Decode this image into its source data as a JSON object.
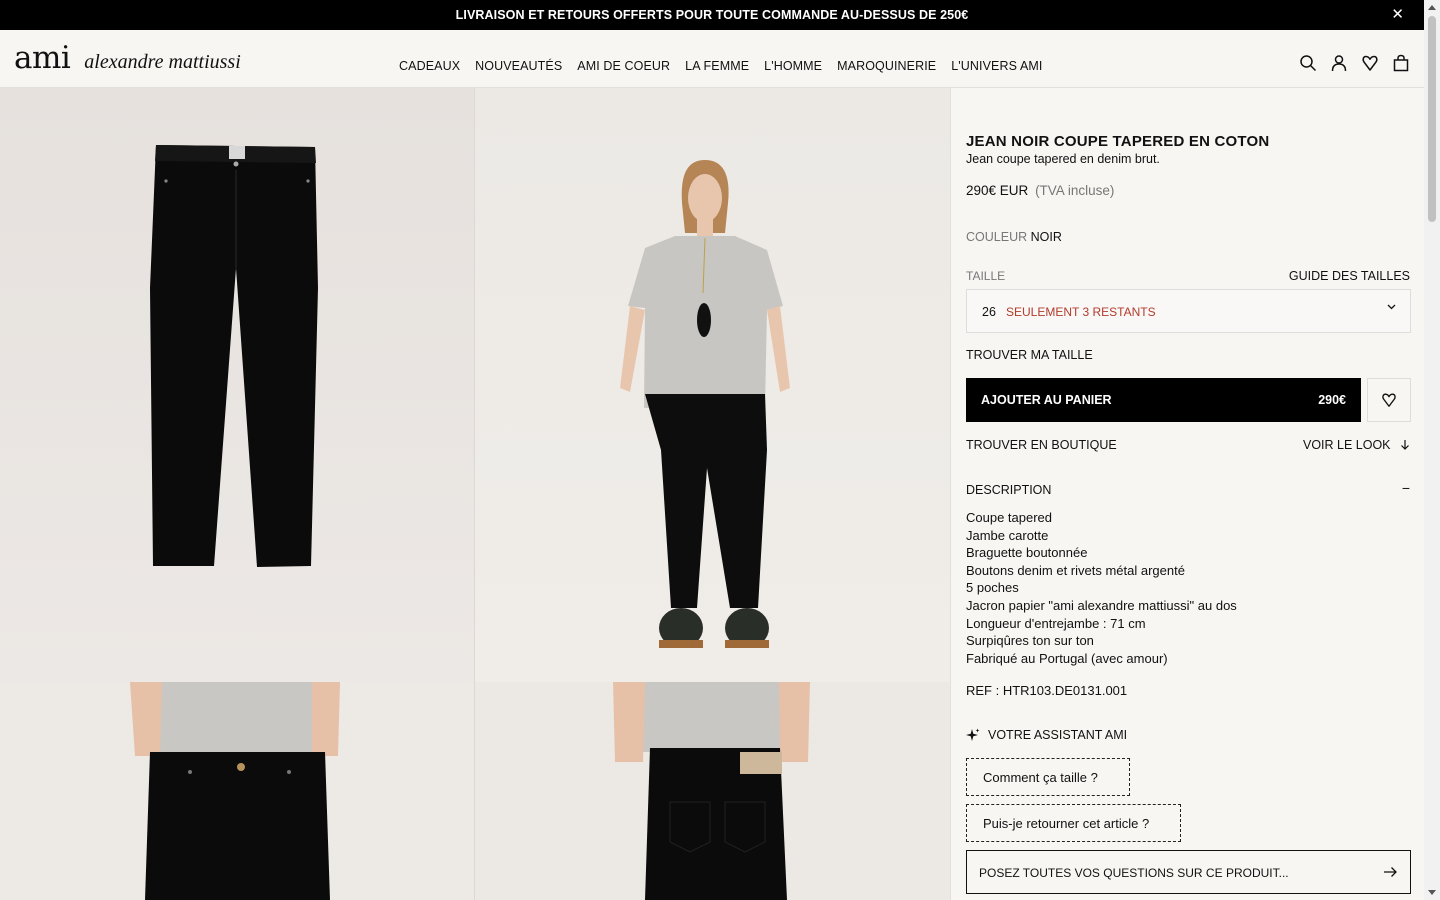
{
  "banner": {
    "text": "LIVRAISON ET RETOURS OFFERTS POUR TOUTE COMMANDE AU-DESSUS DE 250€",
    "close": "✕"
  },
  "header": {
    "logo_mark": "ami",
    "logo_name": "alexandre mattiussi",
    "nav": [
      "CADEAUX",
      "NOUVEAUTÉS",
      "AMI DE COEUR",
      "LA FEMME",
      "L'HOMME",
      "MAROQUINERIE",
      "L'UNIVERS AMI"
    ],
    "icons": [
      "search-icon",
      "account-icon",
      "wishlist-icon",
      "bag-icon"
    ]
  },
  "product": {
    "title": "JEAN NOIR COUPE TAPERED EN COTON",
    "subtitle": "Jean coupe tapered en denim brut.",
    "price": "290€ EUR",
    "tax_note": "(TVA incluse)",
    "color_label": "COULEUR",
    "color_value": "NOIR",
    "size_label": "TAILLE",
    "size_guide": "GUIDE DES TAILLES",
    "size_selected": "26",
    "stock_note": "SEULEMENT 3 RESTANTS",
    "find_size": "TROUVER MA TAILLE",
    "add_to_cart": "AJOUTER AU PANIER",
    "cart_price": "290€",
    "find_store": "TROUVER EN BOUTIQUE",
    "see_look": "VOIR LE LOOK",
    "description_title": "DESCRIPTION",
    "description_toggle": "−",
    "description": [
      "Coupe tapered",
      "Jambe carotte",
      "Braguette boutonnée",
      "Boutons denim et rivets métal argenté",
      "5 poches",
      "Jacron papier \"ami alexandre mattiussi\" au dos",
      "Longueur d'entrejambe : 71 cm",
      "Surpiqûres ton sur ton",
      "Fabriqué au Portugal (avec amour)"
    ],
    "ref": "REF : HTR103.DE0131.001"
  },
  "assistant": {
    "title": "VOTRE ASSISTANT AMI",
    "q1": "Comment ça taille ?",
    "q2": "Puis-je retourner cet article ?",
    "ask": "POSEZ TOUTES VOS QUESTIONS SUR CE PRODUIT..."
  },
  "colors": {
    "accent": "#000000",
    "stock": "#b23b2c",
    "background": "#f7f6f3"
  }
}
